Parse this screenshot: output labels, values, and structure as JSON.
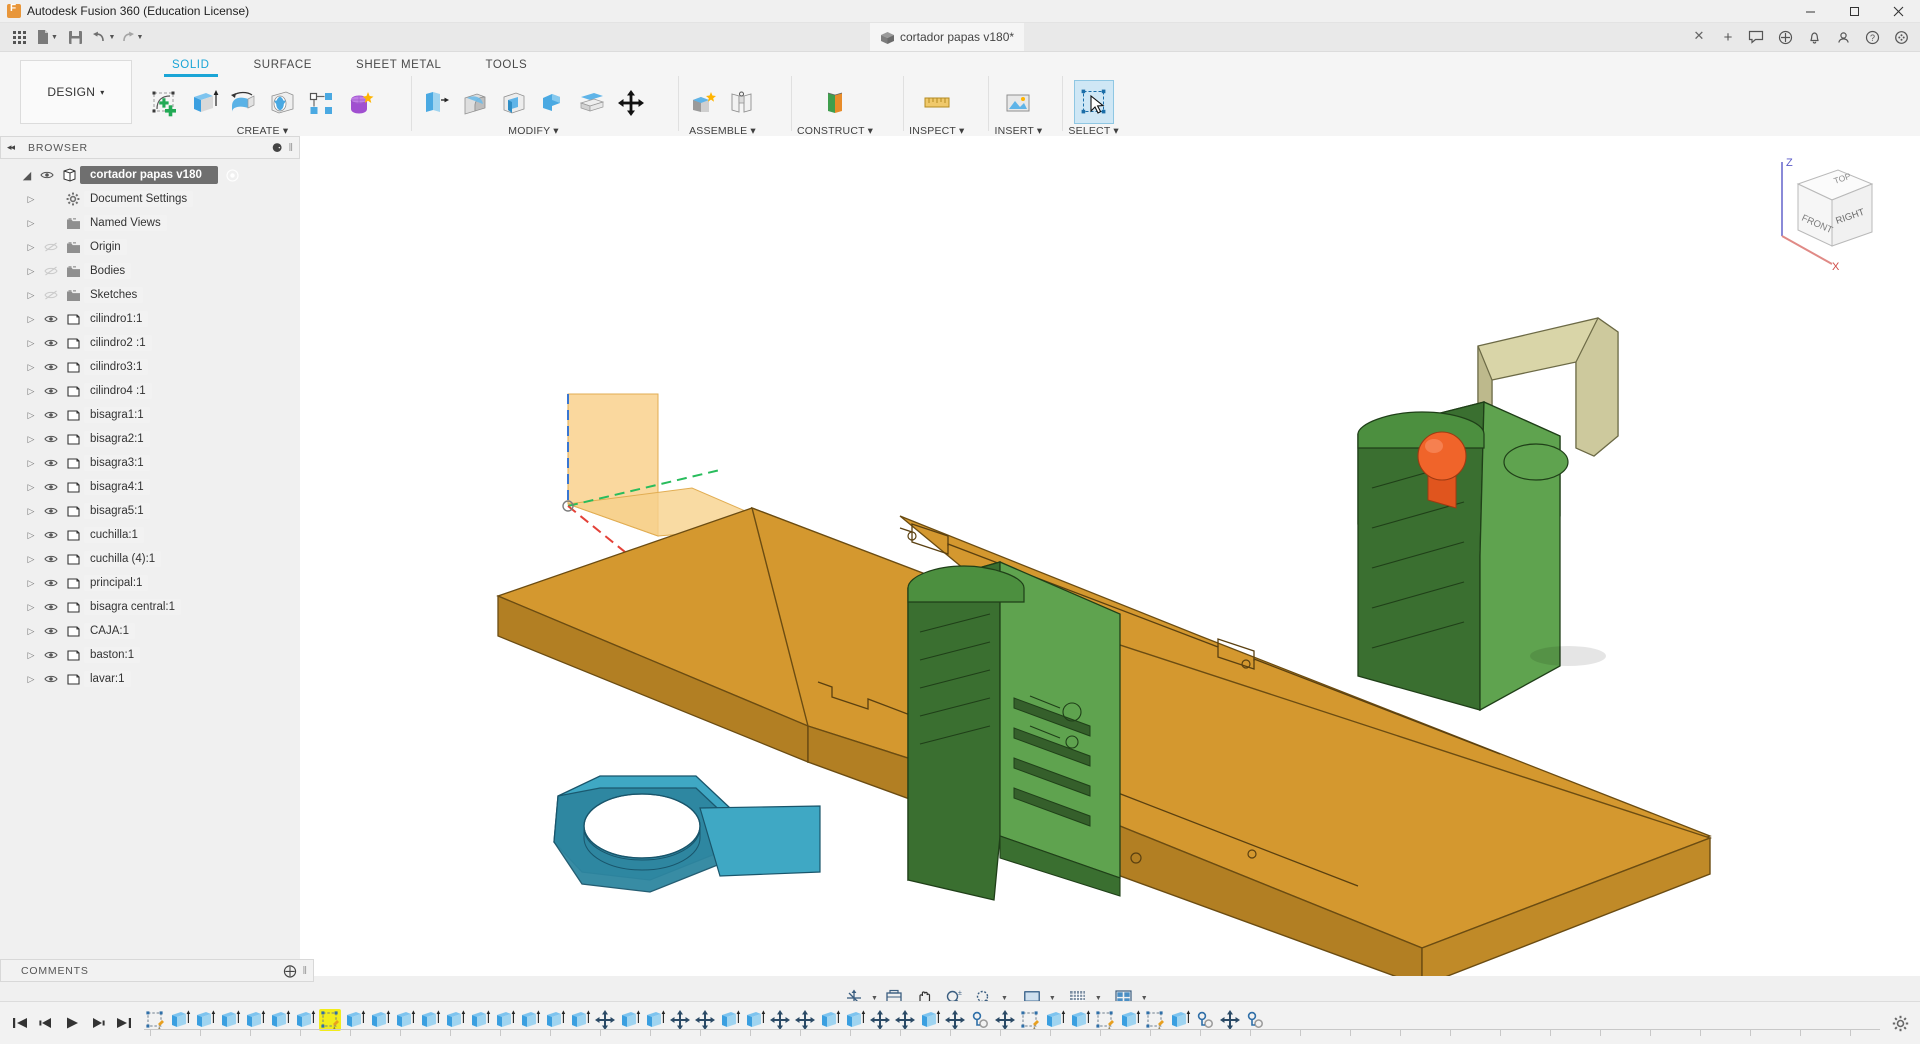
{
  "window": {
    "app_title": "Autodesk Fusion 360 (Education License)",
    "logo_letter": "F",
    "minimize": "–",
    "maximize": "☐",
    "close": "✕"
  },
  "quick_access": {
    "items": [
      {
        "name": "app-grid-icon",
        "label": "",
        "has_caret": false
      },
      {
        "name": "new-file-icon",
        "label": "",
        "has_caret": true
      },
      {
        "name": "save-icon",
        "label": "",
        "has_caret": false
      },
      {
        "name": "undo-icon",
        "label": "",
        "has_caret": true
      },
      {
        "name": "redo-icon",
        "label": "",
        "has_caret": true
      }
    ],
    "document_tab": {
      "title": "cortador papas v180*",
      "close_label": "✕",
      "add_label": "+"
    },
    "right_icons": [
      "chat-icon",
      "extension-icon",
      "bell-icon",
      "user-icon",
      "help-icon",
      "grid-menu-icon"
    ]
  },
  "ribbon": {
    "workspace": "DESIGN",
    "workspace_caret": "▾",
    "tabs": [
      {
        "label": "SOLID",
        "active": true
      },
      {
        "label": "SURFACE",
        "active": false
      },
      {
        "label": "SHEET METAL",
        "active": false
      },
      {
        "label": "TOOLS",
        "active": false
      }
    ],
    "panels": [
      {
        "label": "CREATE",
        "caret": "▾",
        "buttons": [
          {
            "name": "create-sketch-button",
            "icon": "sketch-plus-icon"
          },
          {
            "name": "extrude-button",
            "icon": "extrude-icon"
          },
          {
            "name": "revolve-button",
            "icon": "revolve-icon"
          },
          {
            "name": "sweep-button",
            "icon": "sphere-cut-icon"
          },
          {
            "name": "pattern-button",
            "icon": "pattern-nodes-icon"
          },
          {
            "name": "create-form-button",
            "icon": "form-sculpt-icon"
          }
        ]
      },
      {
        "label": "MODIFY",
        "caret": "▾",
        "buttons": [
          {
            "name": "press-pull-button",
            "icon": "press-pull-icon"
          },
          {
            "name": "fillet-button",
            "icon": "fillet-icon"
          },
          {
            "name": "shell-button",
            "icon": "shell-icon"
          },
          {
            "name": "combine-button",
            "icon": "combine-icon"
          },
          {
            "name": "offset-face-button",
            "icon": "offset-face-icon"
          },
          {
            "name": "move-copy-button",
            "icon": "move-arrows-icon"
          }
        ]
      },
      {
        "label": "ASSEMBLE",
        "caret": "▾",
        "buttons": [
          {
            "name": "new-component-button",
            "icon": "new-component-icon"
          },
          {
            "name": "joint-button",
            "icon": "joint-icon"
          }
        ]
      },
      {
        "label": "CONSTRUCT",
        "caret": "▾",
        "buttons": [
          {
            "name": "offset-plane-button",
            "icon": "offset-plane-icon"
          }
        ]
      },
      {
        "label": "INSPECT",
        "caret": "▾",
        "buttons": [
          {
            "name": "measure-button",
            "icon": "ruler-icon"
          }
        ]
      },
      {
        "label": "INSERT",
        "caret": "▾",
        "buttons": [
          {
            "name": "insert-mcmaster-button",
            "icon": "insert-image-icon"
          }
        ]
      },
      {
        "label": "SELECT",
        "caret": "▾",
        "buttons": [
          {
            "name": "select-button",
            "icon": "cursor-select-icon"
          }
        ]
      }
    ]
  },
  "browser": {
    "header": "BROWSER",
    "collapse_icon": "◂◂",
    "pin_icon": "⊖",
    "root": {
      "label": "cortador papas v180",
      "expanded": true
    },
    "items": [
      {
        "label": "Document Settings",
        "icon": "gear-icon",
        "eye": false,
        "dim": false
      },
      {
        "label": "Named Views",
        "icon": "folder-icon",
        "eye": false,
        "dim": false
      },
      {
        "label": "Origin",
        "icon": "folder-icon",
        "eye": true,
        "dim": true
      },
      {
        "label": "Bodies",
        "icon": "folder-icon",
        "eye": true,
        "dim": true
      },
      {
        "label": "Sketches",
        "icon": "folder-icon",
        "eye": true,
        "dim": true
      },
      {
        "label": "cilindro1:1",
        "icon": "component-icon",
        "eye": true,
        "dim": false
      },
      {
        "label": "cilindro2 :1",
        "icon": "component-icon",
        "eye": true,
        "dim": false
      },
      {
        "label": "cilindro3:1",
        "icon": "component-icon",
        "eye": true,
        "dim": false
      },
      {
        "label": "cilindro4 :1",
        "icon": "component-icon",
        "eye": true,
        "dim": false
      },
      {
        "label": "bisagra1:1",
        "icon": "component-icon",
        "eye": true,
        "dim": false
      },
      {
        "label": "bisagra2:1",
        "icon": "component-icon",
        "eye": true,
        "dim": false
      },
      {
        "label": "bisagra3:1",
        "icon": "component-icon",
        "eye": true,
        "dim": false
      },
      {
        "label": "bisagra4:1",
        "icon": "component-icon",
        "eye": true,
        "dim": false
      },
      {
        "label": "bisagra5:1",
        "icon": "component-icon",
        "eye": true,
        "dim": false
      },
      {
        "label": "cuchilla:1",
        "icon": "component-icon",
        "eye": true,
        "dim": false
      },
      {
        "label": "cuchilla (4):1",
        "icon": "component-icon",
        "eye": true,
        "dim": false
      },
      {
        "label": "principal:1",
        "icon": "component-icon",
        "eye": true,
        "dim": false
      },
      {
        "label": "bisagra central:1",
        "icon": "component-icon",
        "eye": true,
        "dim": false
      },
      {
        "label": "CAJA:1",
        "icon": "component-icon",
        "eye": true,
        "dim": false
      },
      {
        "label": "baston:1",
        "icon": "component-icon",
        "eye": true,
        "dim": false
      },
      {
        "label": "lavar:1",
        "icon": "component-icon",
        "eye": true,
        "dim": false
      }
    ]
  },
  "comments": {
    "header": "COMMENTS",
    "add_icon": "⊕"
  },
  "viewcube": {
    "top": "TOP",
    "front": "FRONT",
    "right": "RIGHT",
    "axis_z": "Z",
    "axis_x": "X"
  },
  "canvas": {
    "model_colors": {
      "wood": "#d4982f",
      "wood_dark": "#b27f23",
      "wood_side": "#c08a28",
      "green": "#4c8f3f",
      "green_dark": "#3a6f30",
      "green_light": "#5fa34f",
      "teal": "#3fa8c4",
      "teal_dark": "#2e86a0",
      "orange": "#f0642a",
      "beige": "#d9d5a8",
      "beige_dark": "#bdb98c"
    },
    "origin_planes": {
      "x_axis_color": "#e2372e",
      "y_axis_color": "#1db954",
      "z_axis_color": "#2f6fd0",
      "plane_fill": "#f5c87a"
    }
  },
  "navbar": {
    "items": [
      {
        "name": "orbit-button",
        "icon": "orbit-icon",
        "caret": true
      },
      {
        "name": "look-at-button",
        "icon": "look-at-icon",
        "caret": false
      },
      {
        "name": "pan-button",
        "icon": "hand-pan-icon",
        "caret": false
      },
      {
        "name": "zoom-button",
        "icon": "zoom-icon",
        "caret": false
      },
      {
        "name": "fit-button",
        "icon": "zoom-fit-icon",
        "caret": true
      },
      {
        "name": "display-settings-button",
        "icon": "monitor-icon",
        "caret": true
      },
      {
        "name": "grid-snaps-button",
        "icon": "grid-icon",
        "caret": true
      },
      {
        "name": "viewports-button",
        "icon": "viewports-icon",
        "caret": true
      }
    ]
  },
  "timeline": {
    "playback": [
      {
        "name": "go-to-beginning-button",
        "icon": "skip-start-icon"
      },
      {
        "name": "step-back-button",
        "icon": "step-back-icon"
      },
      {
        "name": "play-button",
        "icon": "play-icon"
      },
      {
        "name": "step-forward-button",
        "icon": "step-forward-icon"
      },
      {
        "name": "go-to-end-button",
        "icon": "skip-end-icon"
      }
    ],
    "settings_icon": "gear-icon",
    "features": [
      {
        "type": "sketch",
        "highlighted": false
      },
      {
        "type": "extrude",
        "highlighted": false
      },
      {
        "type": "extrude",
        "highlighted": false
      },
      {
        "type": "extrude",
        "highlighted": false
      },
      {
        "type": "extrude",
        "highlighted": false
      },
      {
        "type": "extrude",
        "highlighted": false
      },
      {
        "type": "extrude",
        "highlighted": false
      },
      {
        "type": "sketch",
        "highlighted": true
      },
      {
        "type": "extrude",
        "highlighted": false
      },
      {
        "type": "extrude",
        "highlighted": false
      },
      {
        "type": "extrude",
        "highlighted": false
      },
      {
        "type": "extrude",
        "highlighted": false
      },
      {
        "type": "extrude",
        "highlighted": false
      },
      {
        "type": "extrude",
        "highlighted": false
      },
      {
        "type": "extrude",
        "highlighted": false
      },
      {
        "type": "extrude",
        "highlighted": false
      },
      {
        "type": "extrude",
        "highlighted": false
      },
      {
        "type": "extrude",
        "highlighted": false
      },
      {
        "type": "move",
        "highlighted": false
      },
      {
        "type": "extrude",
        "highlighted": false
      },
      {
        "type": "extrude",
        "highlighted": false
      },
      {
        "type": "move",
        "highlighted": false
      },
      {
        "type": "move",
        "highlighted": false
      },
      {
        "type": "extrude",
        "highlighted": false
      },
      {
        "type": "extrude",
        "highlighted": false
      },
      {
        "type": "move",
        "highlighted": false
      },
      {
        "type": "move",
        "highlighted": false
      },
      {
        "type": "extrude",
        "highlighted": false
      },
      {
        "type": "extrude",
        "highlighted": false
      },
      {
        "type": "move",
        "highlighted": false
      },
      {
        "type": "move",
        "highlighted": false
      },
      {
        "type": "extrude",
        "highlighted": false
      },
      {
        "type": "move",
        "highlighted": false
      },
      {
        "type": "joint",
        "highlighted": false
      },
      {
        "type": "move",
        "highlighted": false
      },
      {
        "type": "sketch",
        "highlighted": false
      },
      {
        "type": "extrude",
        "highlighted": false
      },
      {
        "type": "extrude",
        "highlighted": false
      },
      {
        "type": "sketch",
        "highlighted": false
      },
      {
        "type": "extrude",
        "highlighted": false
      },
      {
        "type": "sketch",
        "highlighted": false
      },
      {
        "type": "extrude",
        "highlighted": false
      },
      {
        "type": "joint",
        "highlighted": false
      },
      {
        "type": "move",
        "highlighted": false
      },
      {
        "type": "joint",
        "highlighted": false
      }
    ]
  }
}
